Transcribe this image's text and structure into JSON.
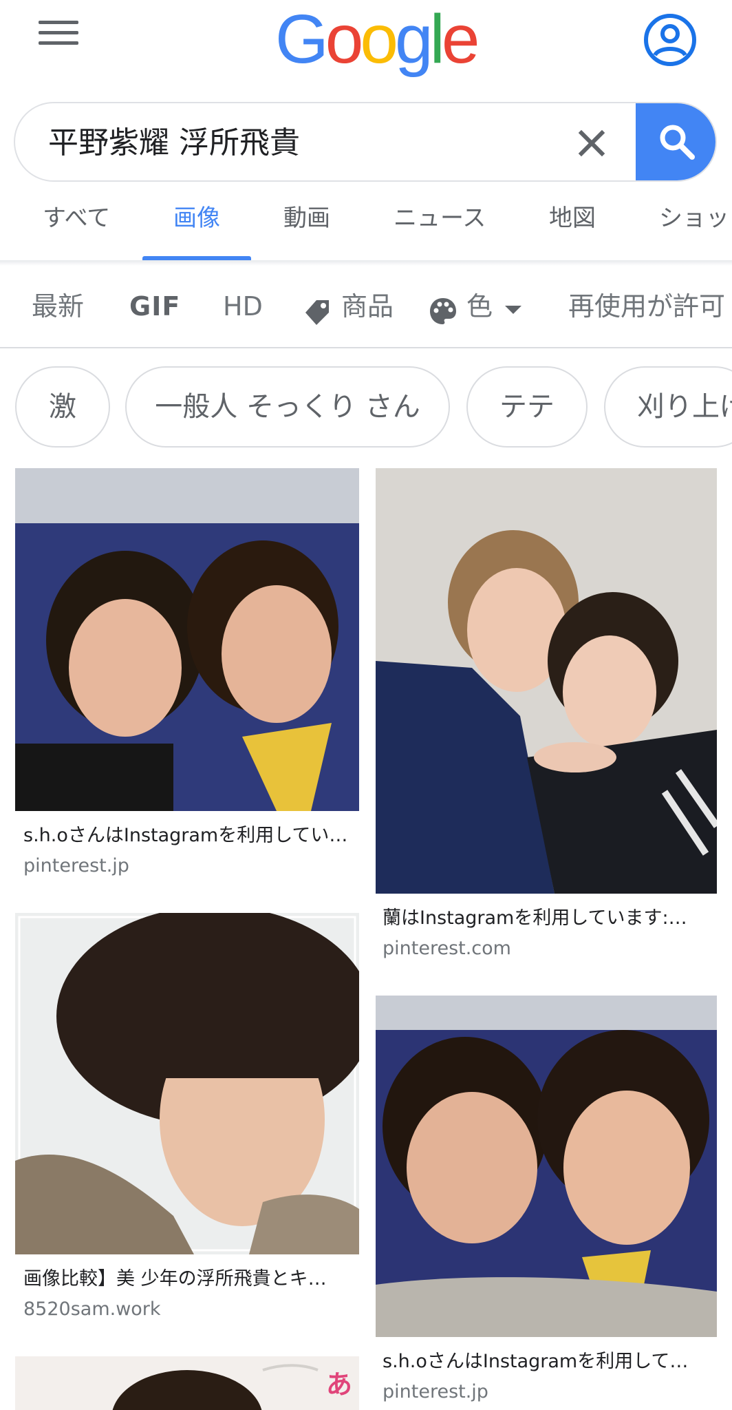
{
  "header": {
    "logo": {
      "l1": "G",
      "l2": "o",
      "l3": "o",
      "l4": "g",
      "l5": "l",
      "l6": "e"
    },
    "menu_icon": "hamburger-menu-icon",
    "account_icon": "account-circle-icon"
  },
  "search": {
    "query": "平野紫耀 浮所飛貴",
    "clear_icon": "close-icon",
    "submit_icon": "search-icon"
  },
  "tabs": [
    {
      "label": "すべて"
    },
    {
      "label": "画像",
      "active": true
    },
    {
      "label": "動画"
    },
    {
      "label": "ニュース"
    },
    {
      "label": "地図"
    },
    {
      "label": "ショッ"
    }
  ],
  "filters": {
    "latest": "最新",
    "gif": "GIF",
    "hd": "HD",
    "products": "商品",
    "color": "色",
    "usage": "再使用が許可"
  },
  "chips": [
    "激",
    "一般人 そっくり さん",
    "テテ",
    "刈り上げ"
  ],
  "results": [
    {
      "caption": "s.h.oさんはInstagramを利用してい…",
      "source": "pinterest.jp"
    },
    {
      "caption": "蘭はInstagramを利用しています:…",
      "source": "pinterest.com"
    },
    {
      "caption": "画像比較】美 少年の浮所飛貴とキ…",
      "source": "8520sam.work"
    },
    {
      "caption": "s.h.oさんはInstagramを利用して…",
      "source": "pinterest.jp"
    },
    {
      "partial_text": "あ"
    }
  ],
  "colors": {
    "accent": "#4285f4",
    "logo_blue": "#4285f4",
    "logo_red": "#ea4335",
    "logo_yellow": "#fbbc05",
    "logo_green": "#34a853"
  }
}
